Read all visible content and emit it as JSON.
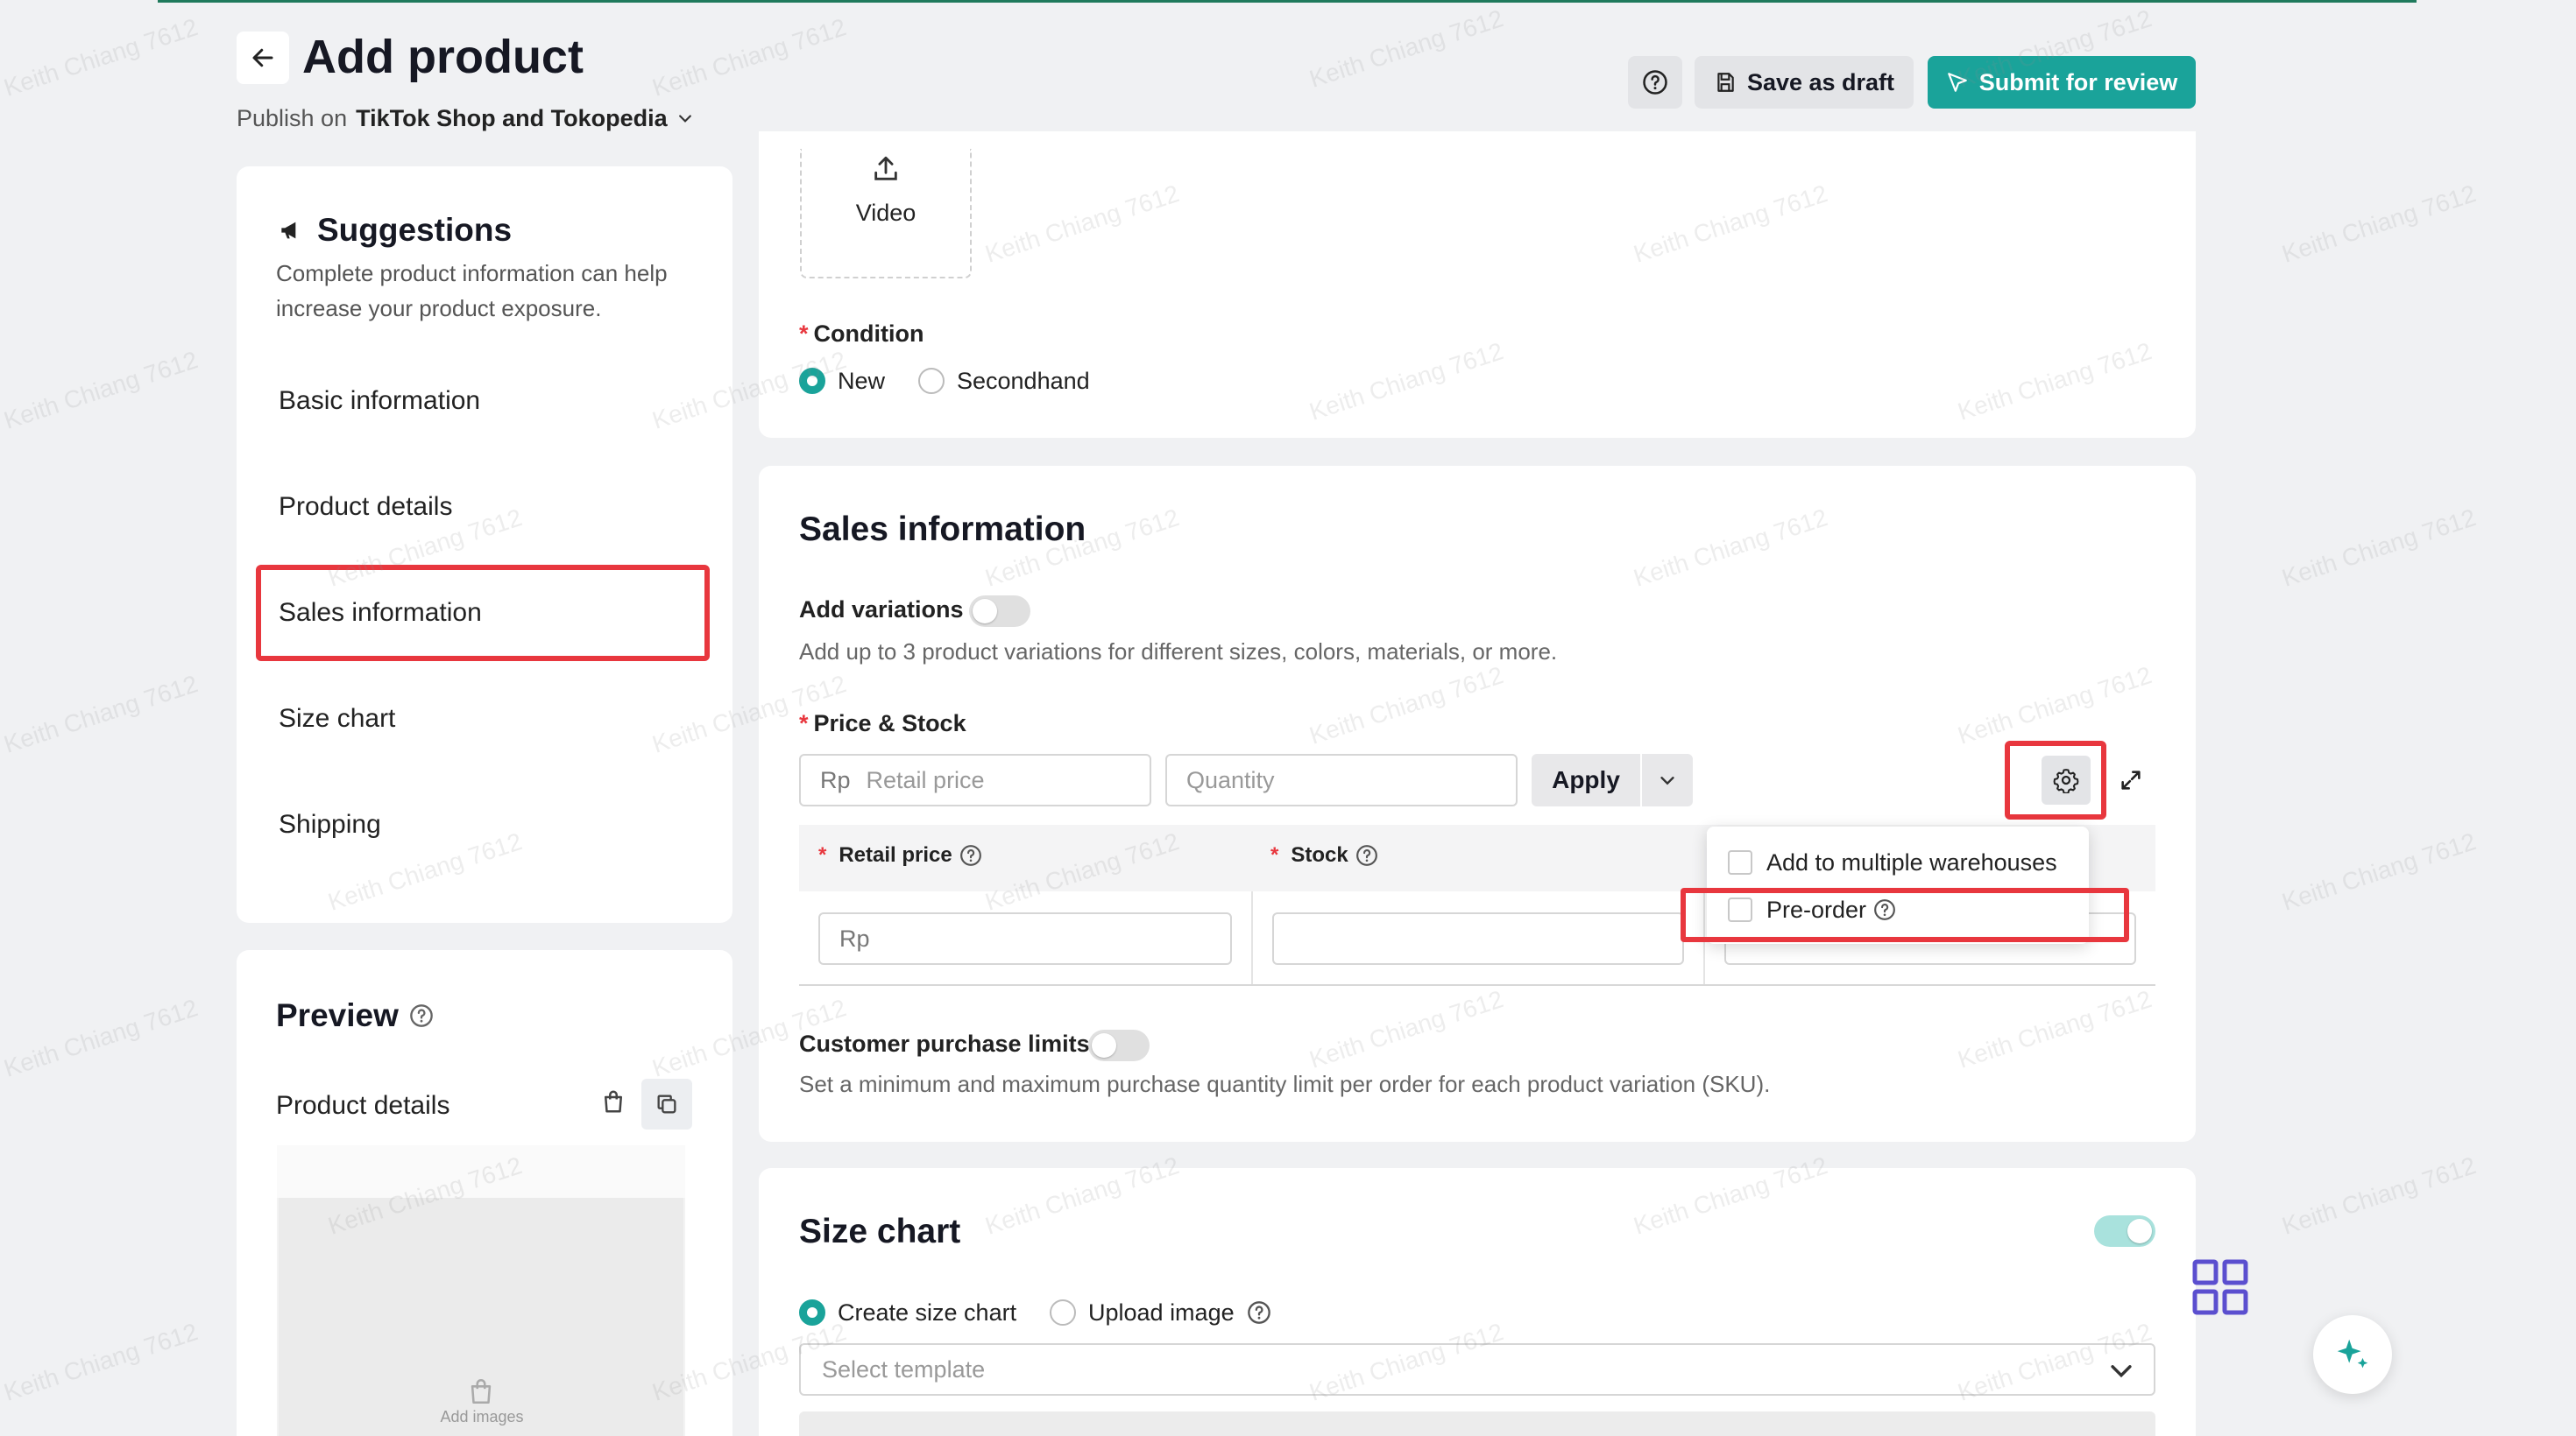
{
  "header": {
    "title": "Add product",
    "publish_prefix": "Publish on",
    "publish_target": "TikTok Shop and Tokopedia",
    "save_draft_label": "Save as draft",
    "submit_label": "Submit for review"
  },
  "sidebar": {
    "suggestions_title": "Suggestions",
    "suggestions_desc": "Complete product information can help increase your product exposure.",
    "items": [
      {
        "label": "Basic information"
      },
      {
        "label": "Product details"
      },
      {
        "label": "Sales information",
        "highlighted": true
      },
      {
        "label": "Size chart"
      },
      {
        "label": "Shipping"
      }
    ],
    "preview_title": "Preview",
    "preview_subtitle": "Product details",
    "add_images_label": "Add images"
  },
  "media": {
    "video_label": "Video"
  },
  "condition": {
    "label": "Condition",
    "options": [
      {
        "label": "New",
        "selected": true
      },
      {
        "label": "Secondhand",
        "selected": false
      }
    ]
  },
  "sales": {
    "title": "Sales information",
    "add_variations_label": "Add variations",
    "add_variations_on": false,
    "add_variations_hint": "Add up to 3 product variations for different sizes, colors, materials, or more.",
    "price_stock_label": "Price & Stock",
    "currency_prefix": "Rp",
    "retail_price_placeholder": "Retail price",
    "quantity_placeholder": "Quantity",
    "apply_label": "Apply",
    "table": {
      "col_retail_price": "Retail price",
      "col_stock": "Stock",
      "row_price_prefix": "Rp"
    },
    "settings_menu": [
      {
        "label": "Add to multiple warehouses",
        "checked": false
      },
      {
        "label": "Pre-order",
        "checked": false
      }
    ],
    "purchase_limits_label": "Customer purchase limits",
    "purchase_limits_on": false,
    "purchase_limits_hint": "Set a minimum and maximum purchase quantity limit per order for each product variation (SKU)."
  },
  "size_chart": {
    "title": "Size chart",
    "enabled": true,
    "options": [
      {
        "label": "Create size chart",
        "selected": true
      },
      {
        "label": "Upload image",
        "selected": false
      }
    ],
    "template_placeholder": "Select template"
  },
  "watermark": "Keith Chiang 7612",
  "colors": {
    "accent": "#1aa39a",
    "highlight": "#e8373e",
    "grid_icon": "#5b4fcf"
  }
}
